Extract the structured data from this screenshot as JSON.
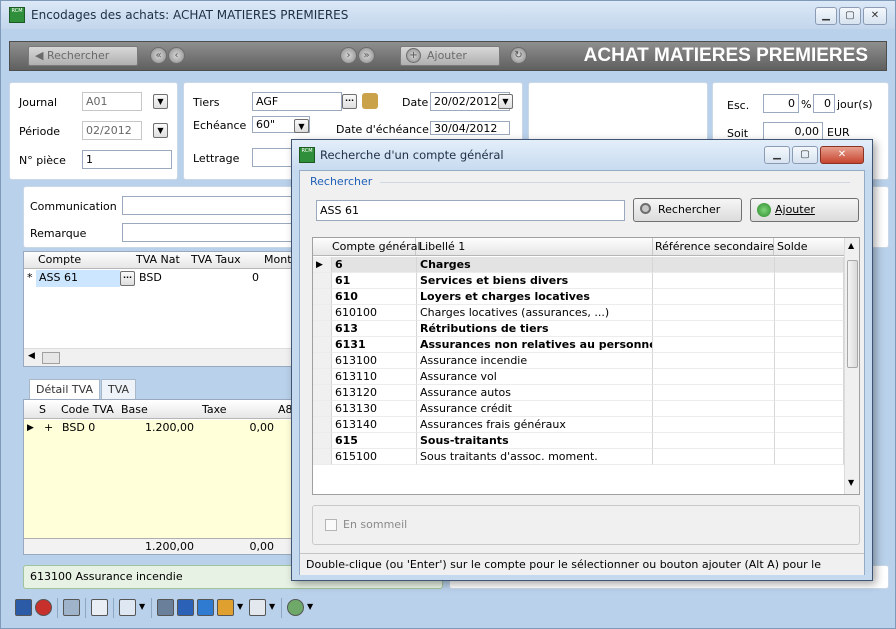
{
  "window": {
    "title": "Encodages des achats:  ACHAT MATIERES PREMIERES",
    "app_icon_text": "RCM"
  },
  "toolbar": {
    "search_label": "Rechercher",
    "add_label": "Ajouter",
    "big_title": "ACHAT MATIERES PREMIERES"
  },
  "form": {
    "journal_label": "Journal",
    "journal_value": "A01",
    "periode_label": "Période",
    "periode_value": "02/2012",
    "piece_label": "N° pièce",
    "piece_value": "1",
    "tiers_label": "Tiers",
    "tiers_value": "AGF",
    "echeance_label": "Echéance",
    "echeance_value": "60\"",
    "lettrage_label": "Lettrage",
    "date_label": "Date",
    "date_value": "20/02/2012",
    "date_echeance_label": "Date d'échéance",
    "date_echeance_value": "30/04/2012",
    "esc_label": "Esc.",
    "esc_pct": "0",
    "esc_pct_unit": "%",
    "esc_days": "0",
    "esc_days_unit": "jour(s)",
    "soit_label": "Soit",
    "soit_value": "0,00",
    "soit_unit": "EUR",
    "communication_label": "Communication",
    "remarque_label": "Remarque"
  },
  "lines_grid": {
    "headers": [
      "Compte",
      "TVA Nat",
      "TVA Taux",
      "Monta"
    ],
    "row": {
      "marker": "*",
      "compte": "ASS 61",
      "tva_nat": "BSD",
      "tva_taux": "0"
    }
  },
  "tva_tabs": [
    "Détail TVA",
    "TVA"
  ],
  "tva_grid": {
    "headers": [
      "S",
      "Code TVA",
      "Base",
      "Taxe",
      "A8"
    ],
    "row": {
      "s": "+",
      "code": "BSD 0",
      "base": "1.200,00",
      "taxe": "0,00"
    },
    "totals": {
      "base": "1.200,00",
      "taxe": "0,00"
    }
  },
  "main_status": "613100  Assurance incendie",
  "dialog": {
    "title": "Recherche d'un compte général",
    "group_label": "Rechercher",
    "search_value": "ASS 61",
    "search_button": "Rechercher",
    "add_button": "Ajouter",
    "headers": [
      "Compte général",
      "Libellé 1",
      "Référence secondaire",
      "Solde"
    ],
    "rows": [
      {
        "compte": "6",
        "libelle": "Charges",
        "bold": true,
        "selected": true
      },
      {
        "compte": "61",
        "libelle": "Services et biens divers",
        "bold": true
      },
      {
        "compte": "610",
        "libelle": "Loyers et charges locatives",
        "bold": true
      },
      {
        "compte": "610100",
        "libelle": "Charges locatives (assurances, ...)",
        "bold": false
      },
      {
        "compte": "613",
        "libelle": "Rétributions de tiers",
        "bold": true
      },
      {
        "compte": "6131",
        "libelle": "Assurances non relatives au personne",
        "bold": true
      },
      {
        "compte": "613100",
        "libelle": "Assurance incendie",
        "bold": false
      },
      {
        "compte": "613110",
        "libelle": "Assurance vol",
        "bold": false
      },
      {
        "compte": "613120",
        "libelle": "Assurance autos",
        "bold": false
      },
      {
        "compte": "613130",
        "libelle": "Assurance crédit",
        "bold": false
      },
      {
        "compte": "613140",
        "libelle": "Assurances frais généraux",
        "bold": false
      },
      {
        "compte": "615",
        "libelle": "Sous-traitants",
        "bold": true
      },
      {
        "compte": "615100",
        "libelle": "Sous traitants d'assoc. moment.",
        "bold": false
      }
    ],
    "checkbox_label": "En sommeil",
    "status": "Double-clique (ou 'Enter') sur le compte pour le sélectionner ou bouton ajouter (Alt A) pour le"
  }
}
